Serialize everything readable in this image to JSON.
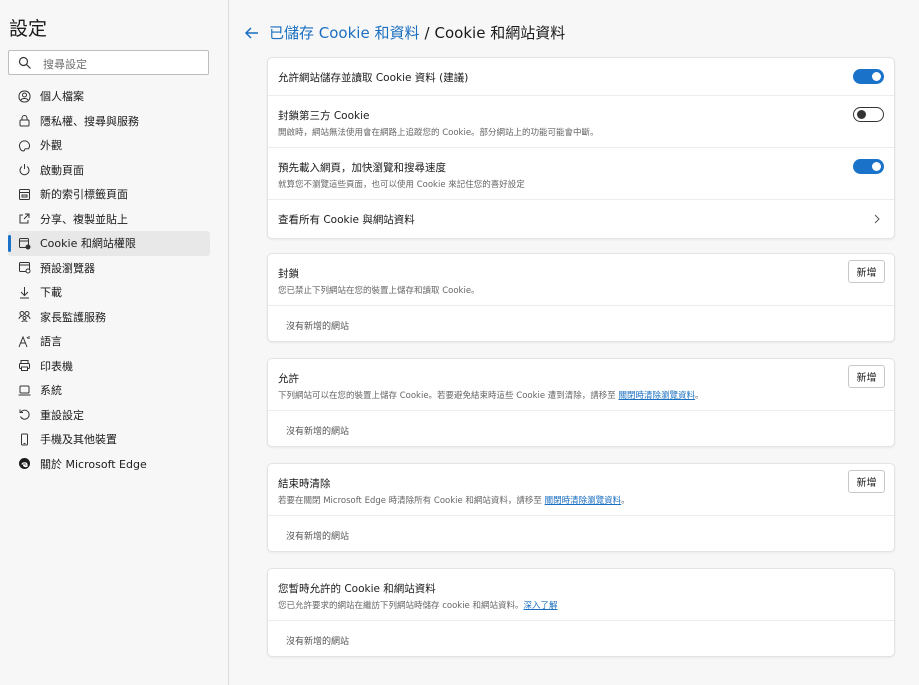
{
  "sidebar": {
    "title": "設定",
    "search_placeholder": "搜尋設定",
    "items": [
      {
        "label": "個人檔案",
        "icon": "profile-icon"
      },
      {
        "label": "隱私權、搜尋與服務",
        "icon": "lock-icon"
      },
      {
        "label": "外觀",
        "icon": "appearance-icon"
      },
      {
        "label": "啟動頁面",
        "icon": "power-icon"
      },
      {
        "label": "新的索引標籤頁面",
        "icon": "new-tab-icon"
      },
      {
        "label": "分享、複製並貼上",
        "icon": "share-icon"
      },
      {
        "label": "Cookie 和網站權限",
        "icon": "cookie-site-icon",
        "active": true
      },
      {
        "label": "預設瀏覽器",
        "icon": "browser-icon"
      },
      {
        "label": "下載",
        "icon": "download-icon"
      },
      {
        "label": "家長監護服務",
        "icon": "family-icon"
      },
      {
        "label": "語言",
        "icon": "language-icon"
      },
      {
        "label": "印表機",
        "icon": "printer-icon"
      },
      {
        "label": "系統",
        "icon": "system-icon"
      },
      {
        "label": "重設設定",
        "icon": "reset-icon"
      },
      {
        "label": "手機及其他裝置",
        "icon": "phone-icon"
      },
      {
        "label": "關於 Microsoft Edge",
        "icon": "edge-icon"
      }
    ]
  },
  "header": {
    "parent": "已儲存 Cookie 和資料",
    "separator": "/",
    "current": "Cookie 和網站資料"
  },
  "settings": {
    "allow_label": "允許網站儲存並讀取 Cookie 資料 (建議)",
    "allow_on": true,
    "block3p_label": "封鎖第三方 Cookie",
    "block3p_desc": "開啟時，網站無法使用會在網路上追蹤您的 Cookie。部分網站上的功能可能會中斷。",
    "block3p_on": false,
    "preload_label": "預先載入網頁，加快瀏覽和搜尋速度",
    "preload_desc": "就算您不瀏覽這些頁面，也可以使用 Cookie 來記住您的喜好設定",
    "preload_on": true,
    "see_all_label": "查看所有 Cookie 與網站資料"
  },
  "block": {
    "title": "封鎖",
    "desc": "您已禁止下列網站在您的裝置上儲存和讀取 Cookie。",
    "add": "新增",
    "empty": "沒有新增的網站"
  },
  "allow": {
    "title": "允許",
    "desc": "下列網站可以在您的裝置上儲存 Cookie。若要避免結束時這些 Cookie 遭到清除，請移至",
    "link": "關閉時清除瀏覽資料",
    "tail": "。",
    "add": "新增",
    "empty": "沒有新增的網站"
  },
  "clear_on_exit": {
    "title": "結束時清除",
    "desc": "若要在關閉 Microsoft Edge 時清除所有 Cookie 和網站資料，請移至",
    "link": "關閉時清除瀏覽資料",
    "tail": "。",
    "add": "新增",
    "empty": "沒有新增的網站"
  },
  "temp_allowed": {
    "title": "您暫時允許的 Cookie 和網站資料",
    "desc": "您已允許要求的網站在繼訪下列網站時儲存 cookie 和網站資料。",
    "link": "深入了解",
    "empty": "沒有新增的網站"
  },
  "colors": {
    "accent": "#1a73c8",
    "link": "#1a6fc0"
  }
}
